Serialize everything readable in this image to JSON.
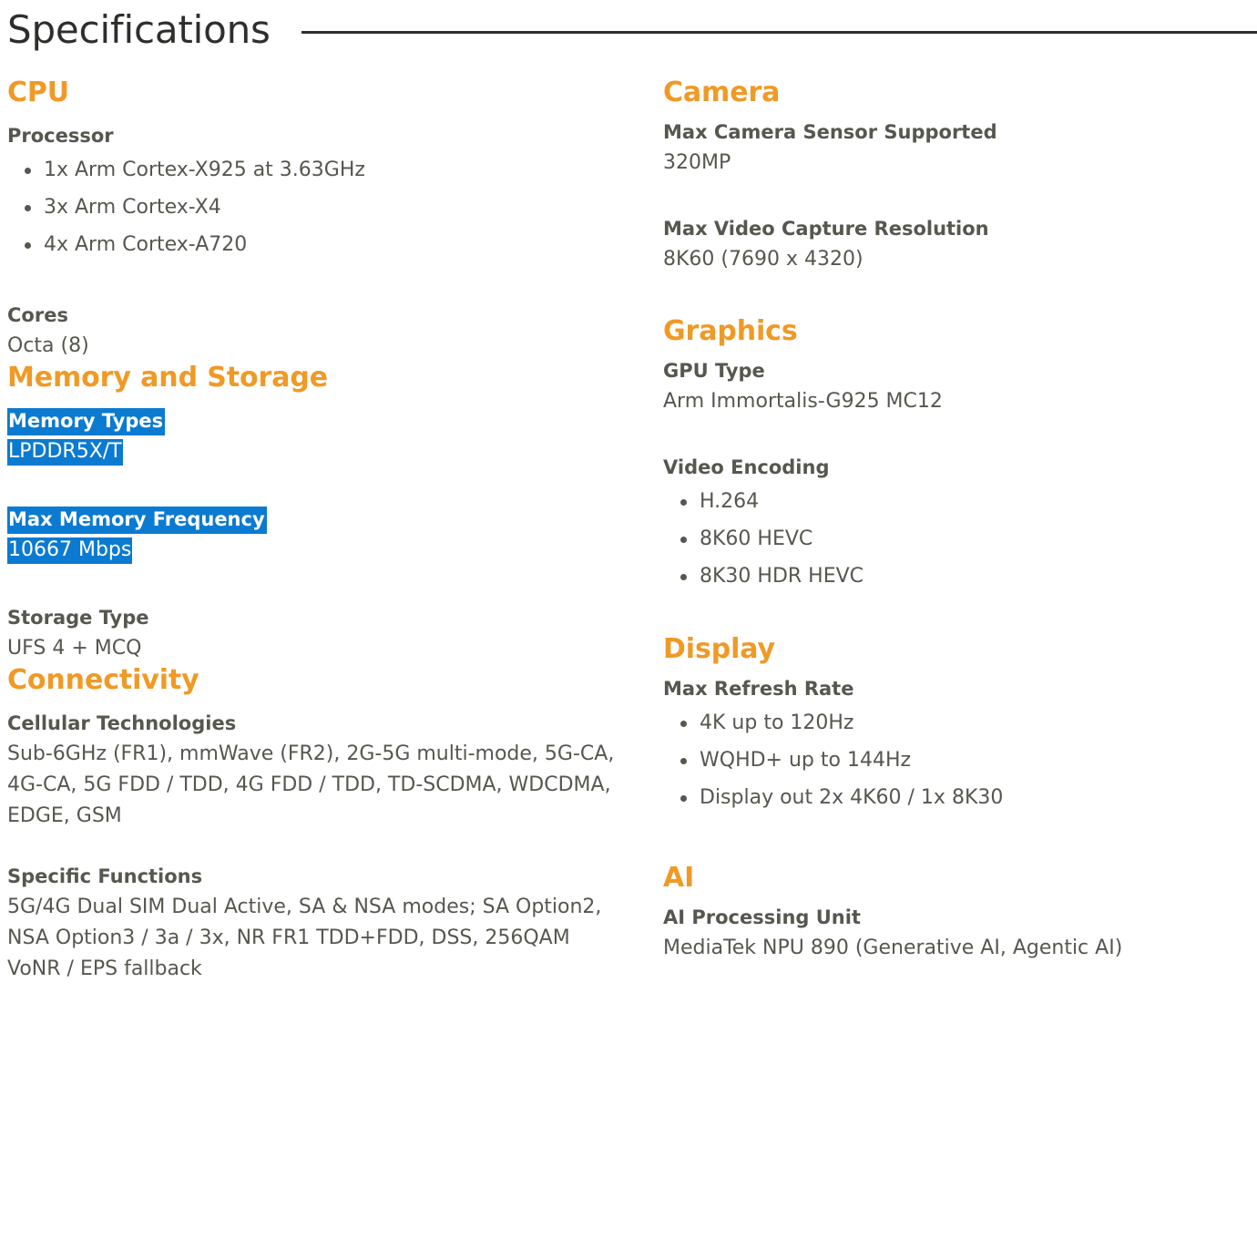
{
  "header": {
    "title": "Specifications",
    "rule_color": "#2e2e2c"
  },
  "colors": {
    "accent_orange": "#ef9a26",
    "body_text": "#56574f",
    "title_text": "#2e2e2c",
    "selection_highlight": "#0b7ad1",
    "selection_text": "#ffffff",
    "background": "#ffffff"
  },
  "left_column": {
    "sections": [
      {
        "heading": "CPU",
        "specs": [
          {
            "label": "Processor",
            "items": [
              "1x Arm Cortex-X925 at 3.63GHz",
              "3x Arm Cortex-X4",
              "4x Arm Cortex-A720"
            ]
          },
          {
            "label": "Cores",
            "value": "Octa (8)"
          }
        ]
      },
      {
        "heading": "Memory and Storage",
        "specs": [
          {
            "label": "Memory Types",
            "value": "LPDDR5X/T",
            "highlighted": true
          },
          {
            "label": "Max Memory Frequency",
            "value": "10667 Mbps",
            "highlighted": true
          },
          {
            "label": "Storage Type",
            "value": "UFS 4 + MCQ"
          }
        ]
      },
      {
        "heading": "Connectivity",
        "specs": [
          {
            "label": "Cellular Technologies",
            "value": "Sub-6GHz (FR1), mmWave (FR2), 2G-5G multi-mode, 5G-CA, 4G-CA, 5G FDD / TDD, 4G FDD / TDD, TD-SCDMA, WDCDMA, EDGE, GSM"
          },
          {
            "label": "Specific Functions",
            "value": "5G/4G Dual SIM Dual Active, SA & NSA modes; SA Option2, NSA Option3 / 3a / 3x, NR FR1 TDD+FDD, DSS, 256QAM VoNR / EPS fallback"
          }
        ]
      }
    ]
  },
  "right_column": {
    "sections": [
      {
        "heading": "Camera",
        "specs": [
          {
            "label": "Max Camera Sensor Supported",
            "value": "320MP"
          },
          {
            "label": "Max Video Capture Resolution",
            "value": "8K60 (7690 x 4320)"
          }
        ]
      },
      {
        "heading": "Graphics",
        "specs": [
          {
            "label": "GPU Type",
            "value": "Arm Immortalis-G925 MC12"
          },
          {
            "label": "Video Encoding",
            "items": [
              "H.264",
              "8K60 HEVC",
              "8K30 HDR HEVC"
            ]
          }
        ]
      },
      {
        "heading": "Display",
        "specs": [
          {
            "label": "Max Refresh Rate",
            "items": [
              "4K up to 120Hz",
              "WQHD+ up to 144Hz",
              "Display out 2x 4K60 / 1x 8K30"
            ]
          }
        ]
      },
      {
        "heading": "AI",
        "specs": [
          {
            "label": "AI Processing Unit",
            "value": "MediaTek NPU 890 (Generative AI, Agentic AI)"
          }
        ]
      }
    ]
  }
}
